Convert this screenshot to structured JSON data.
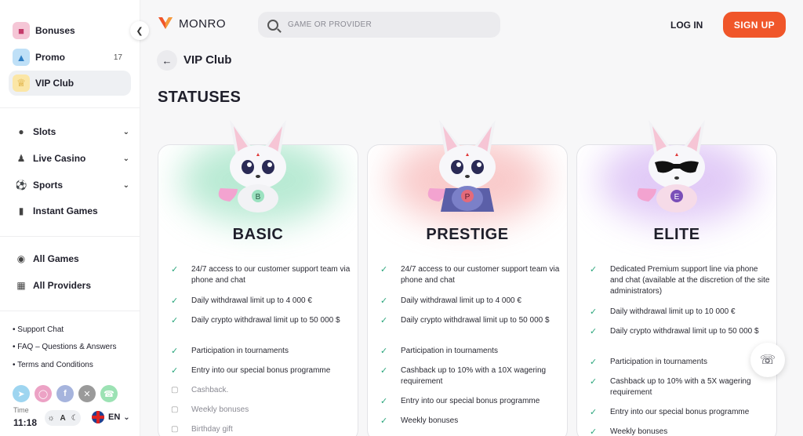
{
  "sidebar": {
    "top_items": [
      {
        "label": "Bonuses",
        "badge": "",
        "icon": "gift-icon"
      },
      {
        "label": "Promo",
        "badge": "17",
        "icon": "promo-icon"
      },
      {
        "label": "VIP Club",
        "badge": "",
        "icon": "crown-icon"
      }
    ],
    "nav_items": [
      {
        "label": "Slots",
        "icon": "cherry-icon"
      },
      {
        "label": "Live Casino",
        "icon": "dealer-icon"
      },
      {
        "label": "Sports",
        "icon": "ball-icon"
      },
      {
        "label": "Instant Games",
        "icon": "chart-icon"
      }
    ],
    "all_items": [
      {
        "label": "All Games",
        "icon": "games-icon"
      },
      {
        "label": "All Providers",
        "icon": "grid-icon"
      }
    ],
    "footer_links": [
      "Support Chat",
      "FAQ – Questions & Answers",
      "Terms and Conditions"
    ],
    "time_label": "Time",
    "time_value": "11:18",
    "theme_label": "A",
    "language": "EN"
  },
  "header": {
    "brand": "MONRO",
    "search_placeholder": "GAME OR PROVIDER",
    "login_label": "LOG IN",
    "signup_label": "SIGN UP"
  },
  "page": {
    "breadcrumb_title": "VIP Club",
    "heading": "STATUSES"
  },
  "statuses": [
    {
      "name": "BASIC",
      "badge_letter": "B",
      "glow_color": "#7fd9b0",
      "features": [
        {
          "text": "24/7 access to our customer support team via phone and chat",
          "locked": false
        },
        {
          "text": "Daily withdrawal limit up to 4 000 €",
          "locked": false
        },
        {
          "text": "Daily crypto withdrawal limit up to 50 000 $",
          "locked": false
        },
        {
          "text": "Participation in tournaments",
          "locked": false
        },
        {
          "text": "Entry into our special bonus programme",
          "locked": false
        },
        {
          "text": "Cashback.",
          "locked": true
        },
        {
          "text": "Weekly bonuses",
          "locked": true
        },
        {
          "text": "Birthday gift",
          "locked": true
        }
      ]
    },
    {
      "name": "PRESTIGE",
      "badge_letter": "P",
      "glow_color": "#f4a0a0",
      "features": [
        {
          "text": "24/7 access to our customer support team via phone and chat",
          "locked": false
        },
        {
          "text": "Daily withdrawal limit up to 4 000 €",
          "locked": false
        },
        {
          "text": "Daily crypto withdrawal limit up to 50 000 $",
          "locked": false
        },
        {
          "text": "Participation in tournaments",
          "locked": false
        },
        {
          "text": "Cashback up to 10% with a 10X wagering requirement",
          "locked": false
        },
        {
          "text": "Entry into our special bonus programme",
          "locked": false
        },
        {
          "text": "Weekly bonuses",
          "locked": false
        }
      ]
    },
    {
      "name": "ELITE",
      "badge_letter": "E",
      "glow_color": "#c9a0f0",
      "features": [
        {
          "text": "Dedicated Premium support line via phone and chat (available at the discretion of the site administrators)",
          "locked": false
        },
        {
          "text": "Daily withdrawal limit up to 10 000 €",
          "locked": false
        },
        {
          "text": "Daily crypto withdrawal limit up to 50 000 $",
          "locked": false
        },
        {
          "text": "Participation in tournaments",
          "locked": false
        },
        {
          "text": "Cashback up to 10% with a 5X wagering requirement",
          "locked": false
        },
        {
          "text": "Entry into our special bonus programme",
          "locked": false
        },
        {
          "text": "Weekly bonuses",
          "locked": false
        }
      ]
    }
  ],
  "colors": {
    "accent": "#f0562a",
    "check": "#2aa57b"
  }
}
